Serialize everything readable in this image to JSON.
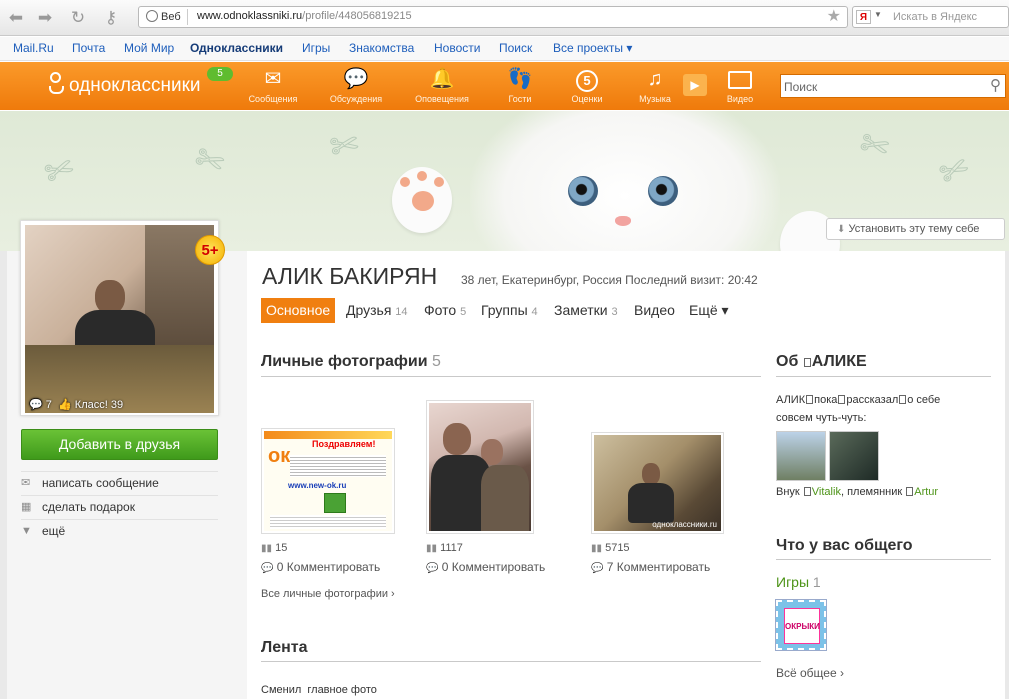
{
  "browser": {
    "web_chip": "Веб",
    "url_host": "www.odnoklassniki.ru",
    "url_path": "/profile/448056819215",
    "yandex_placeholder": "Искать в Яндекс"
  },
  "portal_links": [
    "Mail.Ru",
    "Почта",
    "Мой Мир",
    "Одноклассники",
    "Игры",
    "Знакомства",
    "Новости",
    "Поиск",
    "Все проекты ▾"
  ],
  "topbar": {
    "logo_text": "одноклассники",
    "logo_badge": "5",
    "nav": [
      {
        "label": "Сообщения",
        "icon": "envelope-icon",
        "glyph": "✉"
      },
      {
        "label": "Обсуждения",
        "icon": "discussions-icon",
        "glyph": "💬"
      },
      {
        "label": "Оповещения",
        "icon": "bell-icon",
        "glyph": "🔔"
      },
      {
        "label": "Гости",
        "icon": "footprints-icon",
        "glyph": "👣"
      },
      {
        "label": "Оценки",
        "icon": "rating-icon",
        "glyph": "5"
      },
      {
        "label": "Музыка",
        "icon": "music-note-icon",
        "glyph": "♫"
      },
      {
        "label": "Видео",
        "icon": "video-icon",
        "glyph": "▭"
      }
    ],
    "search_placeholder": "Поиск"
  },
  "banner": {
    "set_theme": "Установить эту тему себе"
  },
  "avatar": {
    "badge": "5+",
    "comments": "7",
    "klass": "Класс! 39"
  },
  "left_actions": {
    "add_friend": "Добавить в друзья",
    "write_message": "написать сообщение",
    "send_gift": "сделать подарок",
    "more": "ещё"
  },
  "profile": {
    "name": "АЛИК БАКИРЯН",
    "meta": "38 лет, Екатеринбург, Россия  Последний визит: 20:42"
  },
  "tabs": [
    {
      "label": "Основное",
      "count": ""
    },
    {
      "label": "Друзья",
      "count": "14"
    },
    {
      "label": "Фото",
      "count": "5"
    },
    {
      "label": "Группы",
      "count": "4"
    },
    {
      "label": "Заметки",
      "count": "3"
    },
    {
      "label": "Видео",
      "count": ""
    },
    {
      "label": "Ещё ▾",
      "count": ""
    }
  ],
  "photos_section": {
    "title": "Личные фотографии",
    "count": "5",
    "photos": [
      {
        "views": "15",
        "comments": "0 Комментировать",
        "poster_title": "Поздравляем!",
        "poster_site": "www.new-ok.ru"
      },
      {
        "views": "1117",
        "comments": "0 Комментировать"
      },
      {
        "views": "5715",
        "comments": "7 Комментировать",
        "watermark": "одноклассники.ru"
      }
    ],
    "all_link": "Все личные фотографии ›"
  },
  "feed": {
    "title": "Лента",
    "item": "Сменил  главное фото"
  },
  "about": {
    "title_prefix": "Об",
    "title_name": "АЛИКЕ",
    "text1": "АЛИК",
    "text2": "пока",
    "text3": "рассказал",
    "text4": "о себе",
    "text5": "совсем чуть-чуть:",
    "rel1": "Внук",
    "friend1": "Vitalik",
    "rel2": ", племянник",
    "friend2": "Artur"
  },
  "common": {
    "title": "Что у вас общего",
    "games_label": "Игры",
    "games_count": "1",
    "all_common": "Всё общее ›",
    "game_stamp_text": "ОКРЫКИ"
  },
  "colors": {
    "orange": "#f07f10",
    "green": "#4d9418",
    "link_blue": "#1e5ebb"
  }
}
